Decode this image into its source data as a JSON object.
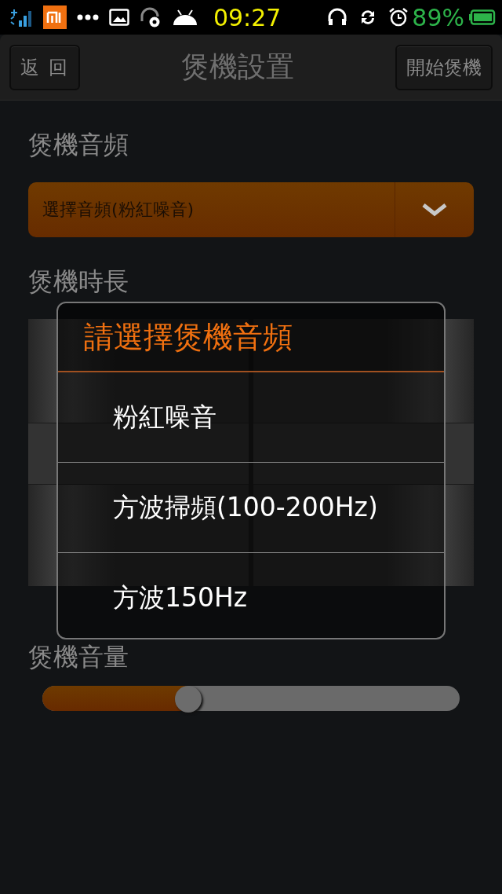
{
  "status_bar": {
    "time": "09:27",
    "battery": "89%"
  },
  "header": {
    "back_button": "返 回",
    "title": "煲機設置",
    "action_button": "開始煲機"
  },
  "audio_section": {
    "label": "煲機音頻",
    "dropdown": {
      "value": "選擇音頻(粉紅噪音)"
    }
  },
  "duration_section": {
    "label": "煲機時長"
  },
  "volume_section": {
    "label": "煲機音量",
    "slider": {
      "level": 0.35
    }
  },
  "dialog": {
    "title": "請選擇煲機音頻",
    "options": [
      {
        "label": "粉紅噪音"
      },
      {
        "label": "方波掃頻(100-200Hz)"
      },
      {
        "label": "方波150Hz"
      }
    ]
  }
}
